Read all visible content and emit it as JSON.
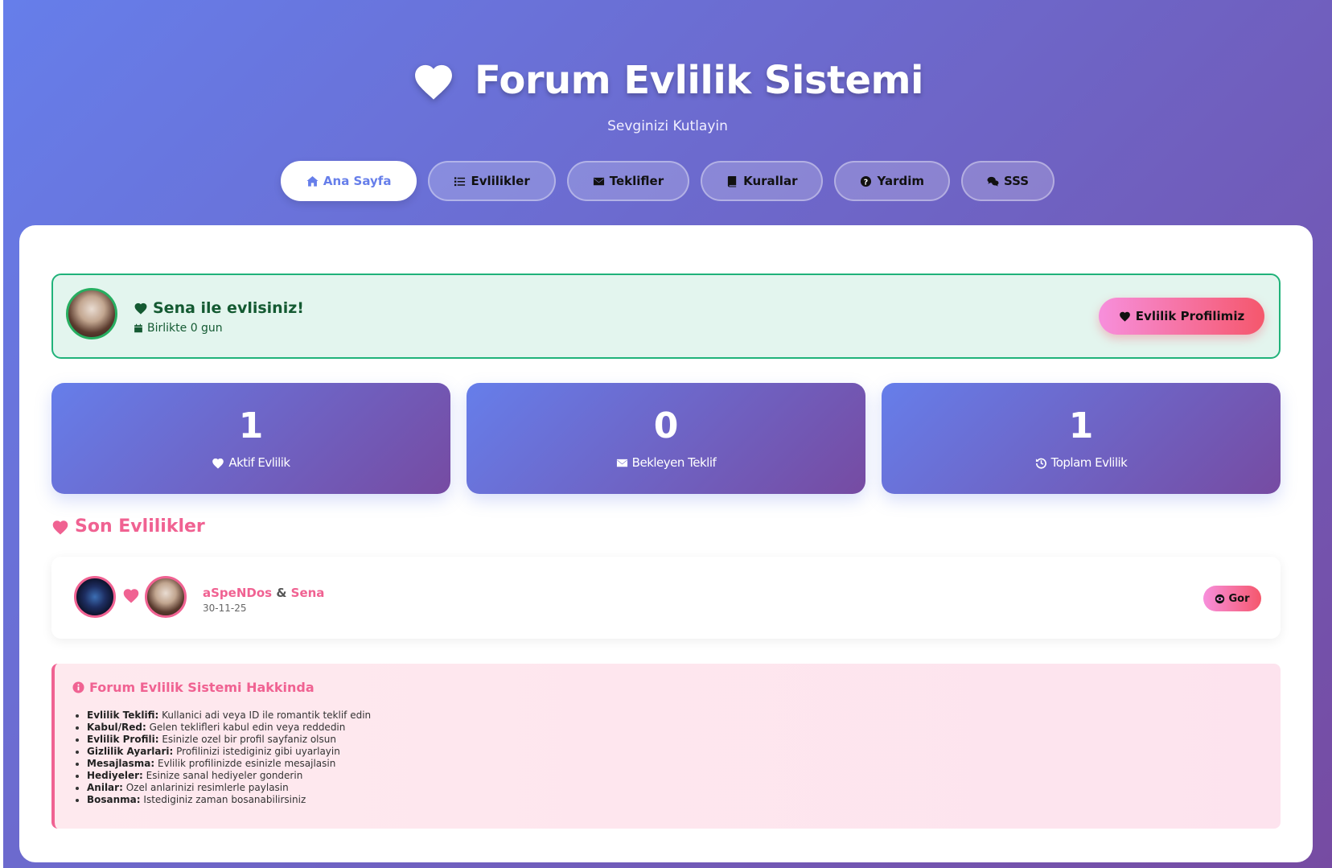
{
  "header": {
    "title": "Forum Evlilik Sistemi",
    "subtitle": "Sevginizi Kutlayin"
  },
  "nav": {
    "items": [
      {
        "label": "Ana Sayfa",
        "icon": "home-icon",
        "active": true
      },
      {
        "label": "Evlilikler",
        "icon": "list-icon"
      },
      {
        "label": "Teklifler",
        "icon": "envelope-icon"
      },
      {
        "label": "Kurallar",
        "icon": "book-icon"
      },
      {
        "label": "Yardim",
        "icon": "question-circle-icon"
      },
      {
        "label": "SSS",
        "icon": "comments-icon"
      }
    ]
  },
  "status": {
    "message": "Sena ile evlisiniz!",
    "duration": "Birlikte 0 gun",
    "profile_button": "Evlilik Profilimiz"
  },
  "stats": [
    {
      "value": "1",
      "label": "Aktif Evlilik",
      "icon": "heart-icon"
    },
    {
      "value": "0",
      "label": "Bekleyen Teklif",
      "icon": "envelope-icon"
    },
    {
      "value": "1",
      "label": "Toplam Evlilik",
      "icon": "history-icon"
    }
  ],
  "recent": {
    "title": "Son Evlilikler",
    "items": [
      {
        "partner1": "aSpeNDos",
        "separator": "&",
        "partner2": "Sena",
        "date": "30-11-25",
        "view_label": "Gor"
      }
    ]
  },
  "info": {
    "title": "Forum Evlilik Sistemi Hakkinda",
    "items": [
      {
        "term": "Evlilik Teklifi:",
        "desc": "Kullanici adi veya ID ile romantik teklif edin"
      },
      {
        "term": "Kabul/Red:",
        "desc": "Gelen teklifleri kabul edin veya reddedin"
      },
      {
        "term": "Evlilik Profili:",
        "desc": "Esinizle ozel bir profil sayfaniz olsun"
      },
      {
        "term": "Gizlilik Ayarlari:",
        "desc": "Profilinizi istediginiz gibi uyarlayin"
      },
      {
        "term": "Mesajlasma:",
        "desc": "Evlilik profilinizde esinizle mesajlasin"
      },
      {
        "term": "Hediyeler:",
        "desc": "Esinize sanal hediyeler gonderin"
      },
      {
        "term": "Anilar:",
        "desc": "Ozel anlarinizi resimlerle paylasin"
      },
      {
        "term": "Bosanma:",
        "desc": "Istediginiz zaman bosanabilirsiniz"
      }
    ]
  },
  "colors": {
    "gradient_start": "#667eea",
    "gradient_end": "#764ba2",
    "accent_pink": "#f06292",
    "success_green": "#20b27a"
  }
}
